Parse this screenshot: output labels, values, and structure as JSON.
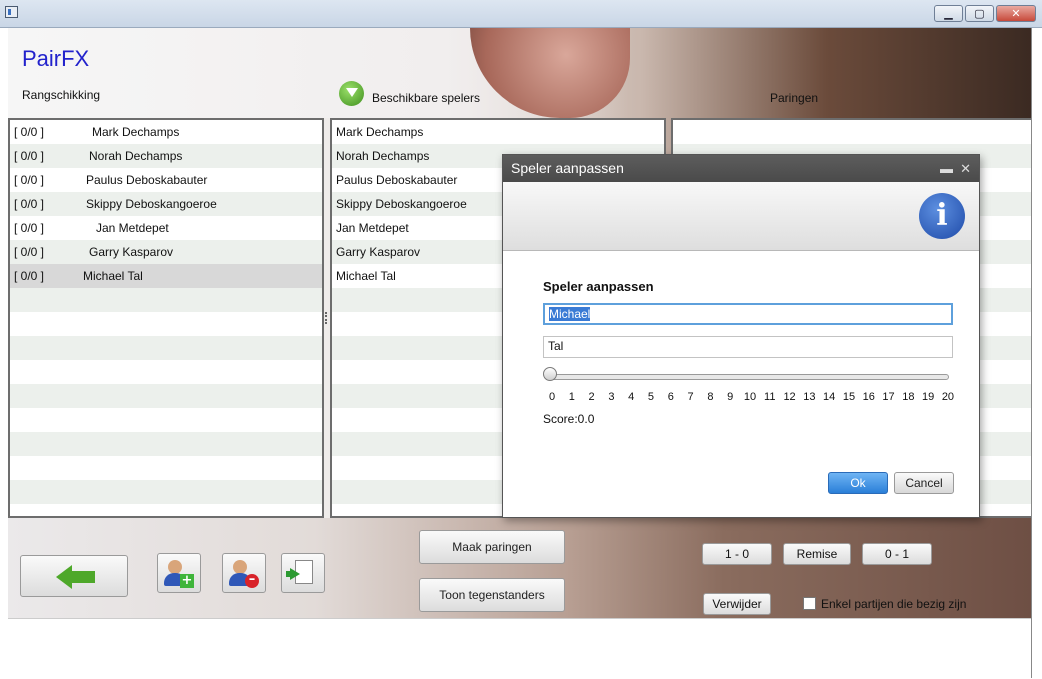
{
  "app": {
    "title": "PairFX"
  },
  "headers": {
    "ranking": "Rangschikking",
    "available": "Beschikbare spelers",
    "pairings": "Paringen"
  },
  "ranking": {
    "rows": [
      {
        "score": "[  0/0   ]",
        "name": "Mark Dechamps"
      },
      {
        "score": "[  0/0   ]",
        "name": "Norah Dechamps"
      },
      {
        "score": "[  0/0   ]",
        "name": "Paulus Deboskabauter"
      },
      {
        "score": "[  0/0   ]",
        "name": "Skippy Deboskangoeroe"
      },
      {
        "score": "[  0/0   ]",
        "name": "Jan Metdepet"
      },
      {
        "score": "[  0/0   ]",
        "name": "Garry Kasparov"
      },
      {
        "score": "[  0/0   ]",
        "name": "Michael Tal"
      }
    ]
  },
  "available": {
    "rows": [
      "Mark Dechamps",
      "Norah Dechamps",
      "Paulus Deboskabauter",
      "Skippy Deboskangoeroe",
      "Jan Metdepet",
      "Garry Kasparov",
      "Michael Tal"
    ]
  },
  "buttons": {
    "make_pairings": "Maak paringen",
    "show_opponents": "Toon tegenstanders",
    "win": "1 - 0",
    "draw": "Remise",
    "loss": "0 - 1",
    "remove": "Verwijder",
    "only_active": "Enkel partijen die bezig zijn"
  },
  "icons": {
    "back": "back-arrow-icon",
    "add_player": "add-user-icon",
    "remove_player": "remove-user-icon",
    "export": "export-document-icon",
    "download": "download-icon",
    "info": "info-icon"
  },
  "dialog": {
    "title": "Speler aanpassen",
    "heading": "Speler aanpassen",
    "first_name": "Michael",
    "last_name": "Tal",
    "slider_ticks": [
      "0",
      "1",
      "2",
      "3",
      "4",
      "5",
      "6",
      "7",
      "8",
      "9",
      "10",
      "11",
      "12",
      "13",
      "14",
      "15",
      "16",
      "17",
      "18",
      "19",
      "20"
    ],
    "slider_value": 0,
    "score_label": "Score:0.0",
    "ok": "Ok",
    "cancel": "Cancel",
    "info_glyph": "i"
  },
  "colors": {
    "app_title": "#2222cc",
    "ok_button": "#2a7fd8",
    "dialog_title_bar": "#4a4a4a"
  }
}
